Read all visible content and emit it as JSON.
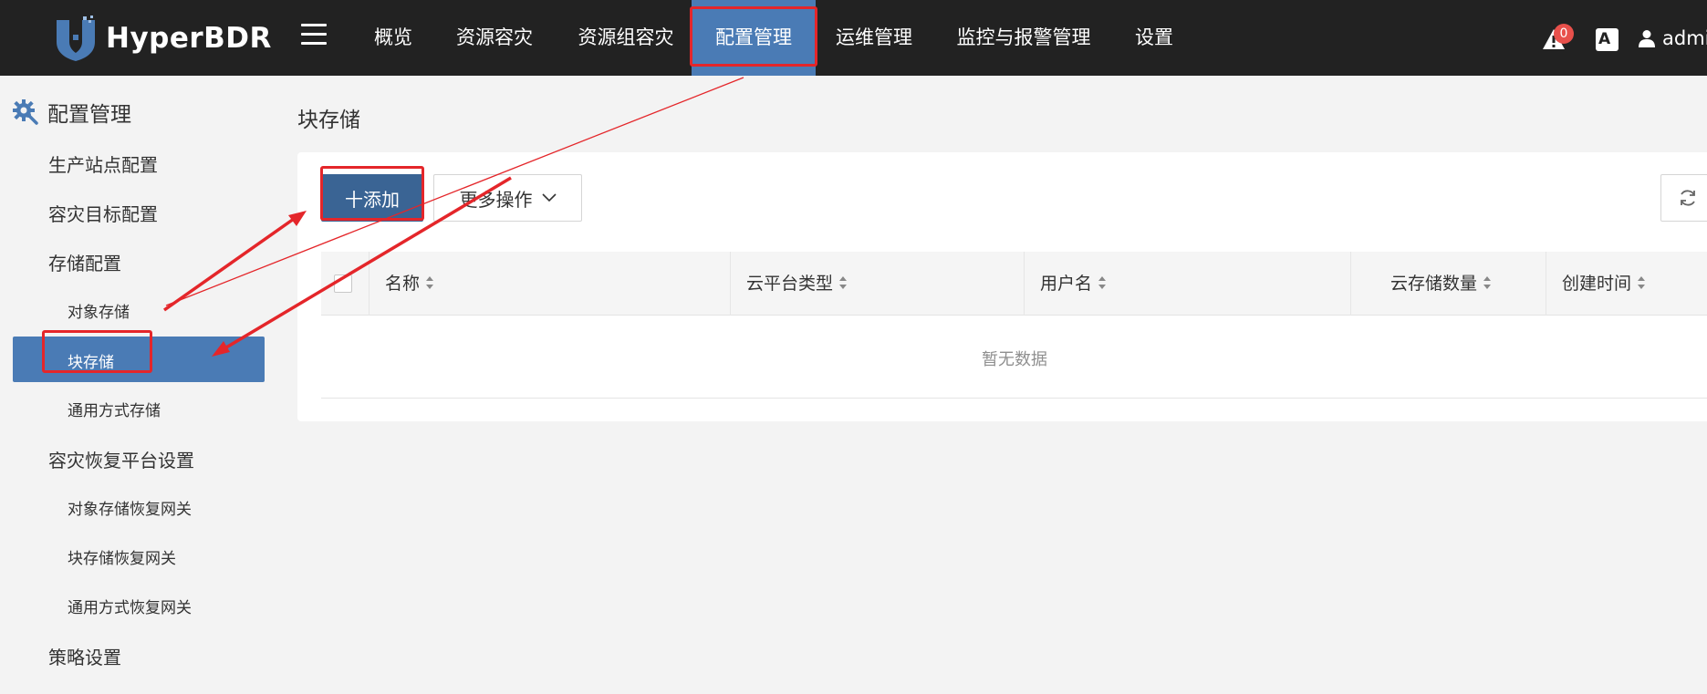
{
  "app": {
    "name": "HyperBDR"
  },
  "nav": {
    "items": [
      {
        "label": "概览"
      },
      {
        "label": "资源容灾"
      },
      {
        "label": "资源组容灾"
      },
      {
        "label": "配置管理"
      },
      {
        "label": "运维管理"
      },
      {
        "label": "监控与报警管理"
      },
      {
        "label": "设置"
      }
    ],
    "active_index": 3
  },
  "topbar": {
    "alert_count": "0",
    "translate_label": "A",
    "user": "admi"
  },
  "sidebar": {
    "header": "配置管理",
    "items": [
      {
        "label": "生产站点配置"
      },
      {
        "label": "容灾目标配置"
      },
      {
        "label": "存储配置"
      },
      {
        "label": "对象存储"
      },
      {
        "label": "块存储"
      },
      {
        "label": "通用方式存储"
      },
      {
        "label": "容灾恢复平台设置"
      },
      {
        "label": "对象存储恢复网关"
      },
      {
        "label": "块存储恢复网关"
      },
      {
        "label": "通用方式恢复网关"
      },
      {
        "label": "策略设置"
      }
    ],
    "active_label": "块存储"
  },
  "main": {
    "title": "块存储",
    "toolbar": {
      "add_label": "十添加",
      "more_label": "更多操作"
    },
    "table": {
      "columns": [
        "名称",
        "云平台类型",
        "用户名",
        "云存储数量",
        "创建时间"
      ],
      "rows": [],
      "empty_text": "暂无数据"
    }
  },
  "colors": {
    "topbar_bg": "#222222",
    "accent": "#4a7bb5",
    "add_button": "#3a6494",
    "annotation": "#e4262a",
    "alert_badge": "#e8504b"
  }
}
